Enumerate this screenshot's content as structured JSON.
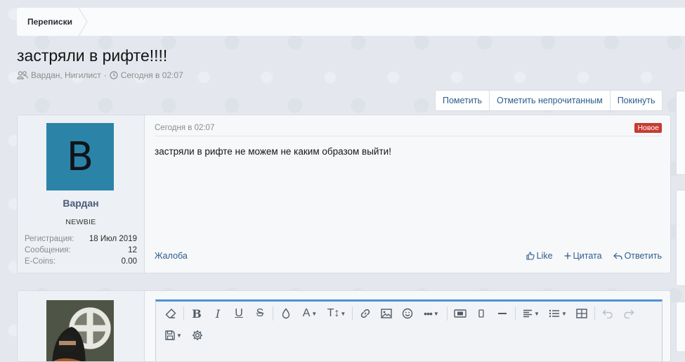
{
  "breadcrumb": {
    "item": "Переписки"
  },
  "thread": {
    "title": "застряли в рифте!!!!",
    "participants": "Вардан, Нигилист",
    "separator": "·",
    "date": "Сегодня в 02:07"
  },
  "actions": {
    "mark": "Пометить",
    "mark_unread": "Отметить непрочитанным",
    "leave": "Покинуть"
  },
  "post": {
    "avatar_letter": "В",
    "username": "Вардан",
    "user_title": "NEWBIE",
    "stats": [
      {
        "key": "Регистрация:",
        "value": "18 Июл 2019"
      },
      {
        "key": "Сообщения:",
        "value": "12"
      },
      {
        "key": "E-Coins:",
        "value": "0.00"
      }
    ],
    "date": "Сегодня в 02:07",
    "badge": "Новое",
    "text": "застряли в рифте не можем не каким образом выйти!",
    "report": "Жалоба",
    "like": "Like",
    "quote": "Цитата",
    "reply": "Ответить"
  },
  "editor": {
    "toolbar_icons": [
      "eraser-icon",
      "bold-icon",
      "italic-icon",
      "underline-icon",
      "strikethrough-icon",
      "text-color-icon",
      "font-family-icon",
      "font-size-icon",
      "link-icon",
      "image-icon",
      "emoji-icon",
      "more-icon",
      "media-icon",
      "spoiler-icon",
      "horizontal-rule-icon",
      "align-icon",
      "list-icon",
      "table-icon",
      "undo-icon",
      "redo-icon",
      "drafts-icon",
      "settings-icon"
    ]
  },
  "colors": {
    "link": "#2c5e8c",
    "badge_new": "#c63b31",
    "avatar_bg": "#2b84a8",
    "editor_accent": "#4d93d6"
  }
}
